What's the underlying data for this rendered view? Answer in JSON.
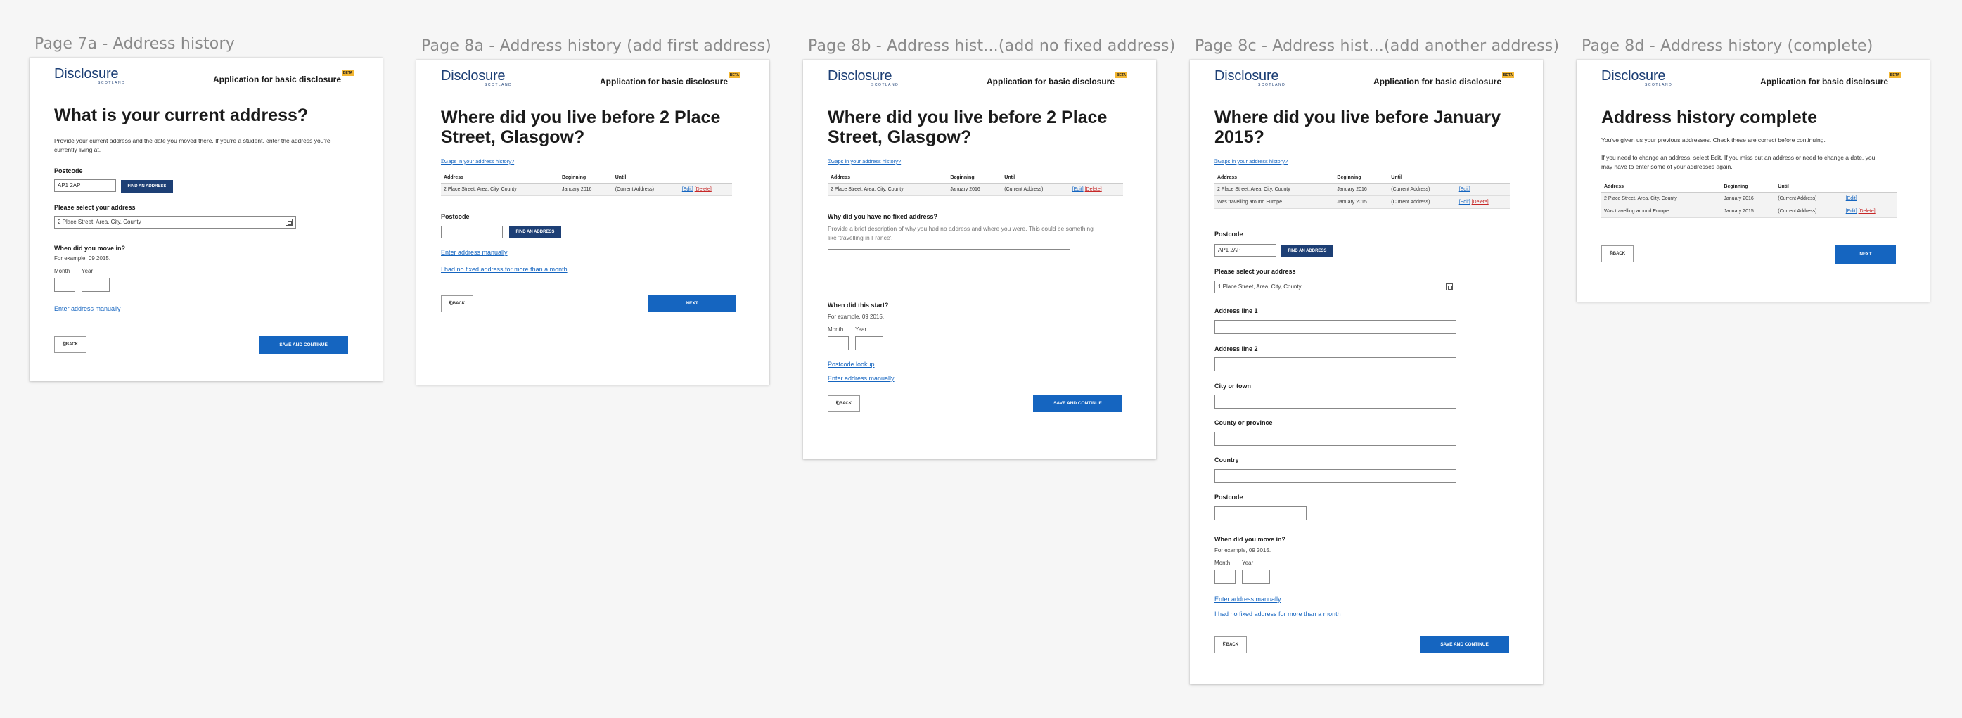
{
  "header": {
    "logo_text": "Disclosure",
    "logo_sub": "SCOTLAND",
    "app_title": "Application for basic disclosure",
    "beta": "BETA"
  },
  "pages": [
    {
      "label": "Page 7a - Address history",
      "heading": "What is your current address?",
      "intro": "Provide your current address and the date you moved there. If you're a student, enter the address you're currently living at.",
      "postcode_label": "Postcode",
      "postcode_value": "AP1 2AP",
      "find_button": "FIND AN ADDRESS",
      "select_label": "Please select your address",
      "select_value": "2 Place Street, Area, City, County",
      "moved_in_label": "When did you move in?",
      "date_hint": "For example, 09 2015.",
      "month_label": "Month",
      "year_label": "Year",
      "manual_link": "Enter address manually",
      "back_button": "BACK",
      "continue_button": "SAVE AND CONTINUE"
    },
    {
      "label": "Page 8a - Address history (add first address)",
      "heading": "Where did you live before 2 Place Street, Glasgow?",
      "history_link": "Gaps in your address history?",
      "table_headers": [
        "Address",
        "Beginning",
        "Until",
        ""
      ],
      "rows": [
        {
          "address": "2 Place Street, Area, City, County",
          "beginning": "January 2016",
          "until": "(Current Address)",
          "edit": "[Edit]",
          "delete": "[Delete]"
        }
      ],
      "postcode_label": "Postcode",
      "find_button": "FIND AN ADDRESS",
      "manual_link": "Enter address manually",
      "no_fixed_link": "I had no fixed address for more than a month",
      "back_button": "BACK",
      "next_button": "NEXT"
    },
    {
      "label": "Page 8b - Address hist...(add no fixed address)",
      "heading": "Where did you live before 2 Place Street, Glasgow?",
      "history_link": "Gaps in your address history?",
      "table_headers": [
        "Address",
        "Beginning",
        "Until",
        ""
      ],
      "rows": [
        {
          "address": "2 Place Street, Area, City, County",
          "beginning": "January 2016",
          "until": "(Current Address)",
          "edit": "[Edit]",
          "delete": "[Delete]"
        }
      ],
      "question": "Why did you have no fixed address?",
      "question_hint": "Provide a brief description of why you had no address and where you were. This could be something like 'travelling in France'.",
      "start_label": "When did this start?",
      "date_hint": "For example, 09 2015.",
      "month_label": "Month",
      "year_label": "Year",
      "lookup_link": "Postcode lookup",
      "manual_link": "Enter address manually",
      "back_button": "BACK",
      "continue_button": "SAVE AND CONTINUE"
    },
    {
      "label": "Page 8c - Address hist...(add another address)",
      "heading": "Where did you live before January 2015?",
      "history_link": "Gaps in your address history?",
      "table_headers": [
        "Address",
        "Beginning",
        "Until",
        ""
      ],
      "rows": [
        {
          "address": "2 Place Street, Area, City, County",
          "beginning": "January 2016",
          "until": "(Current Address)",
          "edit": "[Edit]",
          "delete": ""
        },
        {
          "address": "Was travelling around Europe",
          "beginning": "January 2015",
          "until": "(Current Address)",
          "edit": "[Edit]",
          "delete": "[Delete]"
        }
      ],
      "postcode_label": "Postcode",
      "postcode_value": "AP1 2AP",
      "find_button": "FIND AN ADDRESS",
      "select_label": "Please select your address",
      "select_value": "1 Place Street, Area, City, County",
      "fields": [
        "Address line 1",
        "Address line 2",
        "City or town",
        "County or province",
        "Country",
        "Postcode"
      ],
      "moved_in_label": "When did you move in?",
      "date_hint": "For example, 09 2015.",
      "month_label": "Month",
      "year_label": "Year",
      "manual_link": "Enter address manually",
      "no_fixed_link": "I had no fixed address for more than a month",
      "back_button": "BACK",
      "continue_button": "SAVE AND CONTINUE"
    },
    {
      "label": "Page 8d - Address history (complete)",
      "heading": "Address history complete",
      "intro1": "You've given us your previous addresses. Check these are correct before continuing.",
      "intro2": "If you need to change an address, select Edit. If you miss out an address or need to change a date, you may have to enter some of your addresses again.",
      "table_headers": [
        "Address",
        "Beginning",
        "Until",
        ""
      ],
      "rows": [
        {
          "address": "2 Place Street, Area, City, County",
          "beginning": "January 2016",
          "until": "(Current Address)",
          "edit": "[Edit]",
          "delete": ""
        },
        {
          "address": "Was travelling around Europe",
          "beginning": "January 2015",
          "until": "(Current Address)",
          "edit": "[Edit]",
          "delete": "[Delete]"
        }
      ],
      "back_button": "BACK",
      "next_button": "NEXT"
    }
  ]
}
